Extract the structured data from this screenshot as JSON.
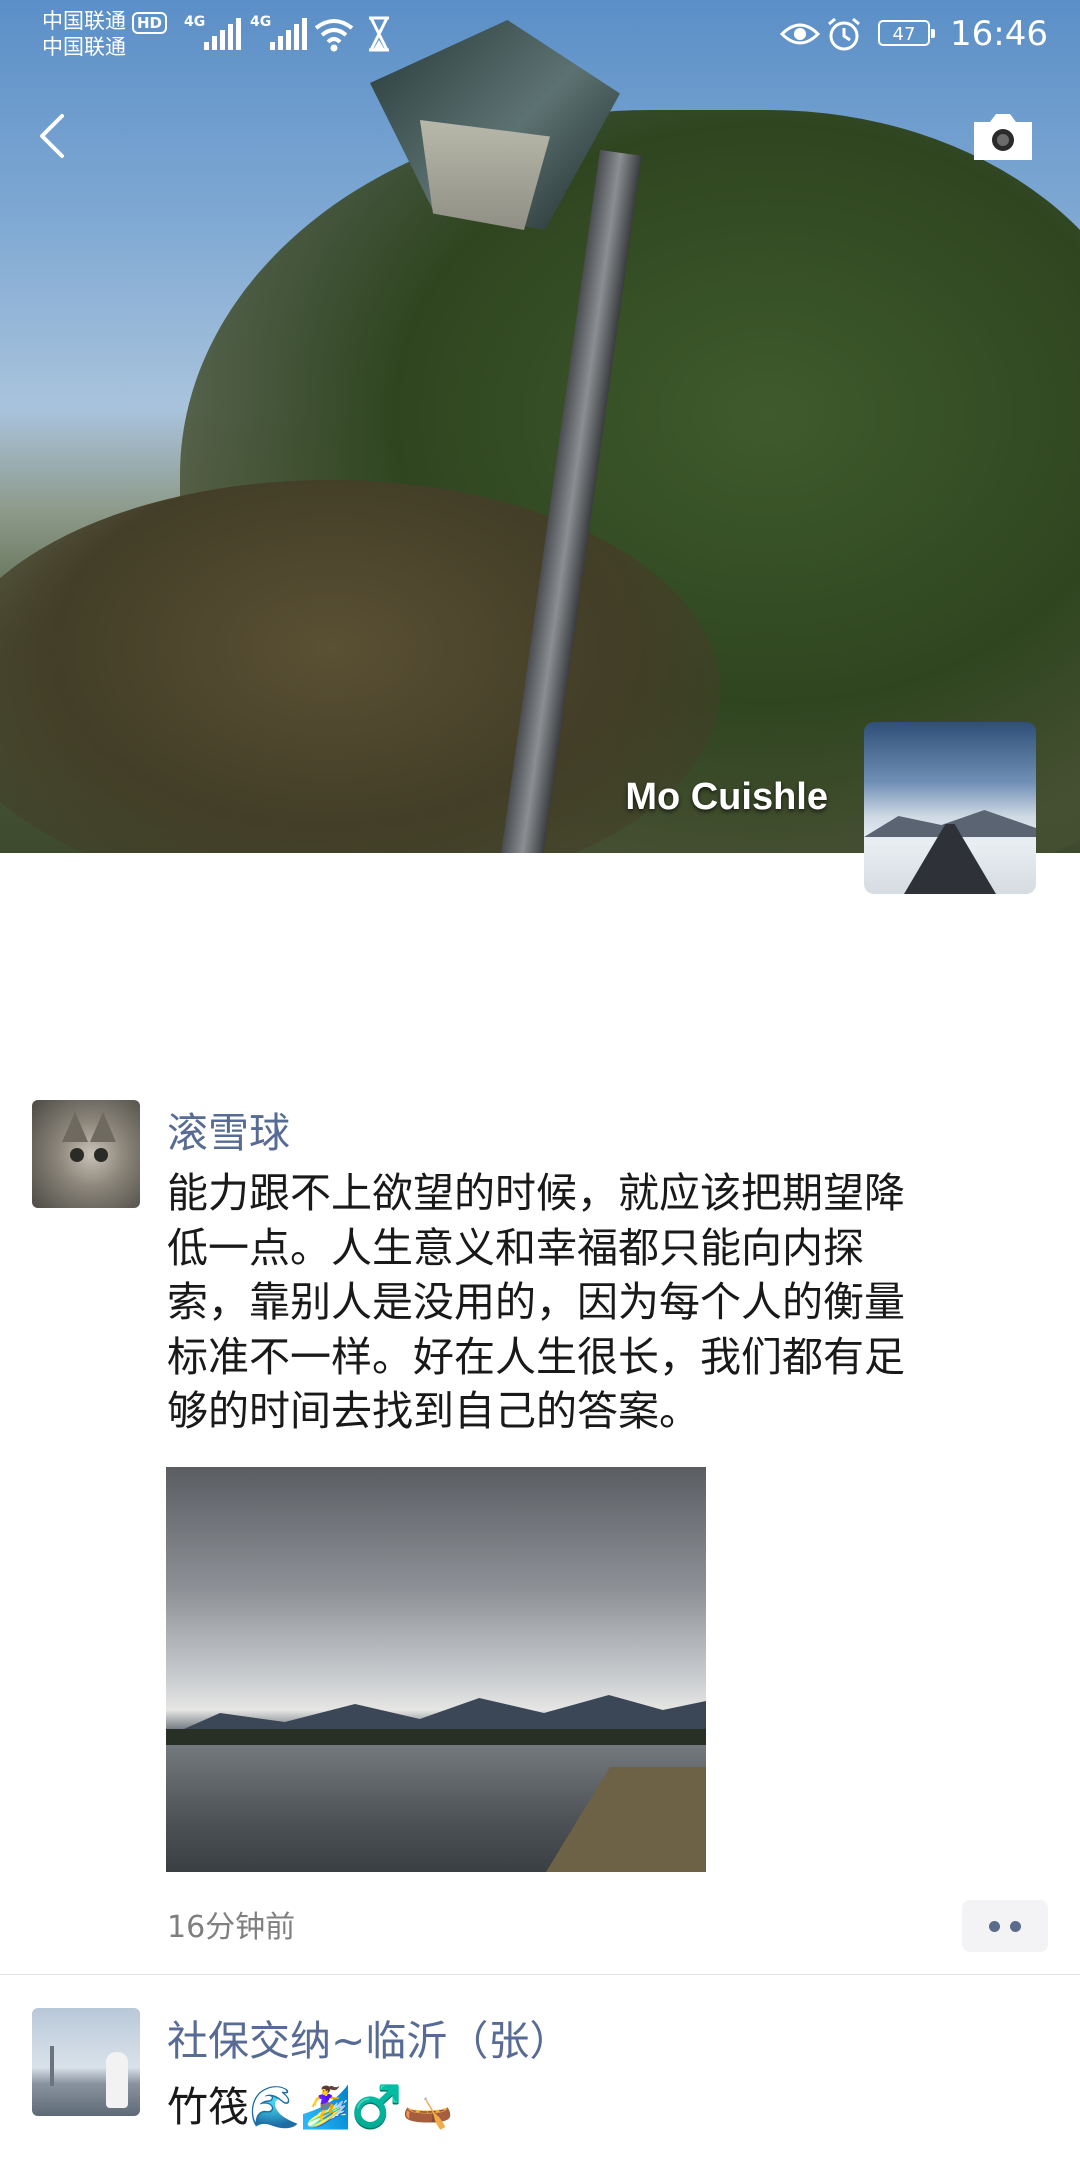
{
  "status_bar": {
    "carrier_1": "中国联通",
    "hd_badge": "HD",
    "carrier_2": "中国联通",
    "network_1": "4G",
    "network_2": "4G",
    "battery": "47",
    "time": "16:46"
  },
  "profile": {
    "username": "Mo Cuishle"
  },
  "posts": [
    {
      "author": "滚雪球",
      "text_lines": [
        "能力跟不上欲望的时候，就应该把期望降",
        "低一点。人生意义和幸福都只能向内探",
        "索，靠别人是没用的，因为每个人的衡量",
        "标准不一样。好在人生很长，我们都有足",
        "够的时间去找到自己的答案。"
      ],
      "time": "16分钟前"
    },
    {
      "author": "社保交纳~临沂（张）",
      "text": "竹筏🌊🏄‍♀️♂️🛶"
    }
  ],
  "colors": {
    "author_name": "#576b95",
    "body_text": "#191919",
    "timestamp": "#7f7f7f"
  }
}
